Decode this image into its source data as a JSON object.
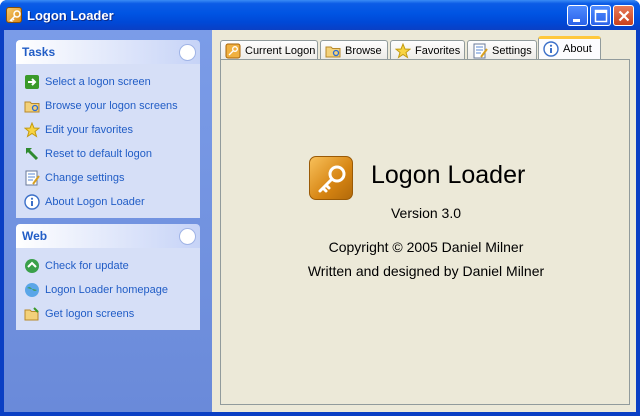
{
  "window": {
    "title": "Logon Loader"
  },
  "taskpane": {
    "groups": [
      {
        "title": "Tasks",
        "items": [
          {
            "label": "Select a logon screen",
            "icon": "green-arrow-icon"
          },
          {
            "label": "Browse your logon screens",
            "icon": "folder-icon"
          },
          {
            "label": "Edit your favorites",
            "icon": "star-icon"
          },
          {
            "label": "Reset to default logon",
            "icon": "reset-arrow-icon"
          },
          {
            "label": "Change settings",
            "icon": "settings-icon"
          },
          {
            "label": "About Logon Loader",
            "icon": "info-icon"
          }
        ]
      },
      {
        "title": "Web",
        "items": [
          {
            "label": "Check for update",
            "icon": "globe-icon"
          },
          {
            "label": "Logon Loader homepage",
            "icon": "homepage-icon"
          },
          {
            "label": "Get logon screens",
            "icon": "folder-open-icon"
          }
        ]
      }
    ]
  },
  "tabs": [
    {
      "label": "Current Logon",
      "icon": "key-icon"
    },
    {
      "label": "Browse",
      "icon": "folder-icon"
    },
    {
      "label": "Favorites",
      "icon": "star-icon"
    },
    {
      "label": "Settings",
      "icon": "settings-icon"
    },
    {
      "label": "About",
      "icon": "info-icon",
      "active": true
    }
  ],
  "about": {
    "app_name": "Logon Loader",
    "version": "Version 3.0",
    "copyright": "Copyright © 2005 Daniel Milner",
    "credits": "Written and designed by Daniel Milner"
  },
  "colors": {
    "titlebar": "#0054e3",
    "taskpane": "#7b9ce8",
    "link": "#215dc6",
    "active_tab_accent": "#ffc83c"
  }
}
